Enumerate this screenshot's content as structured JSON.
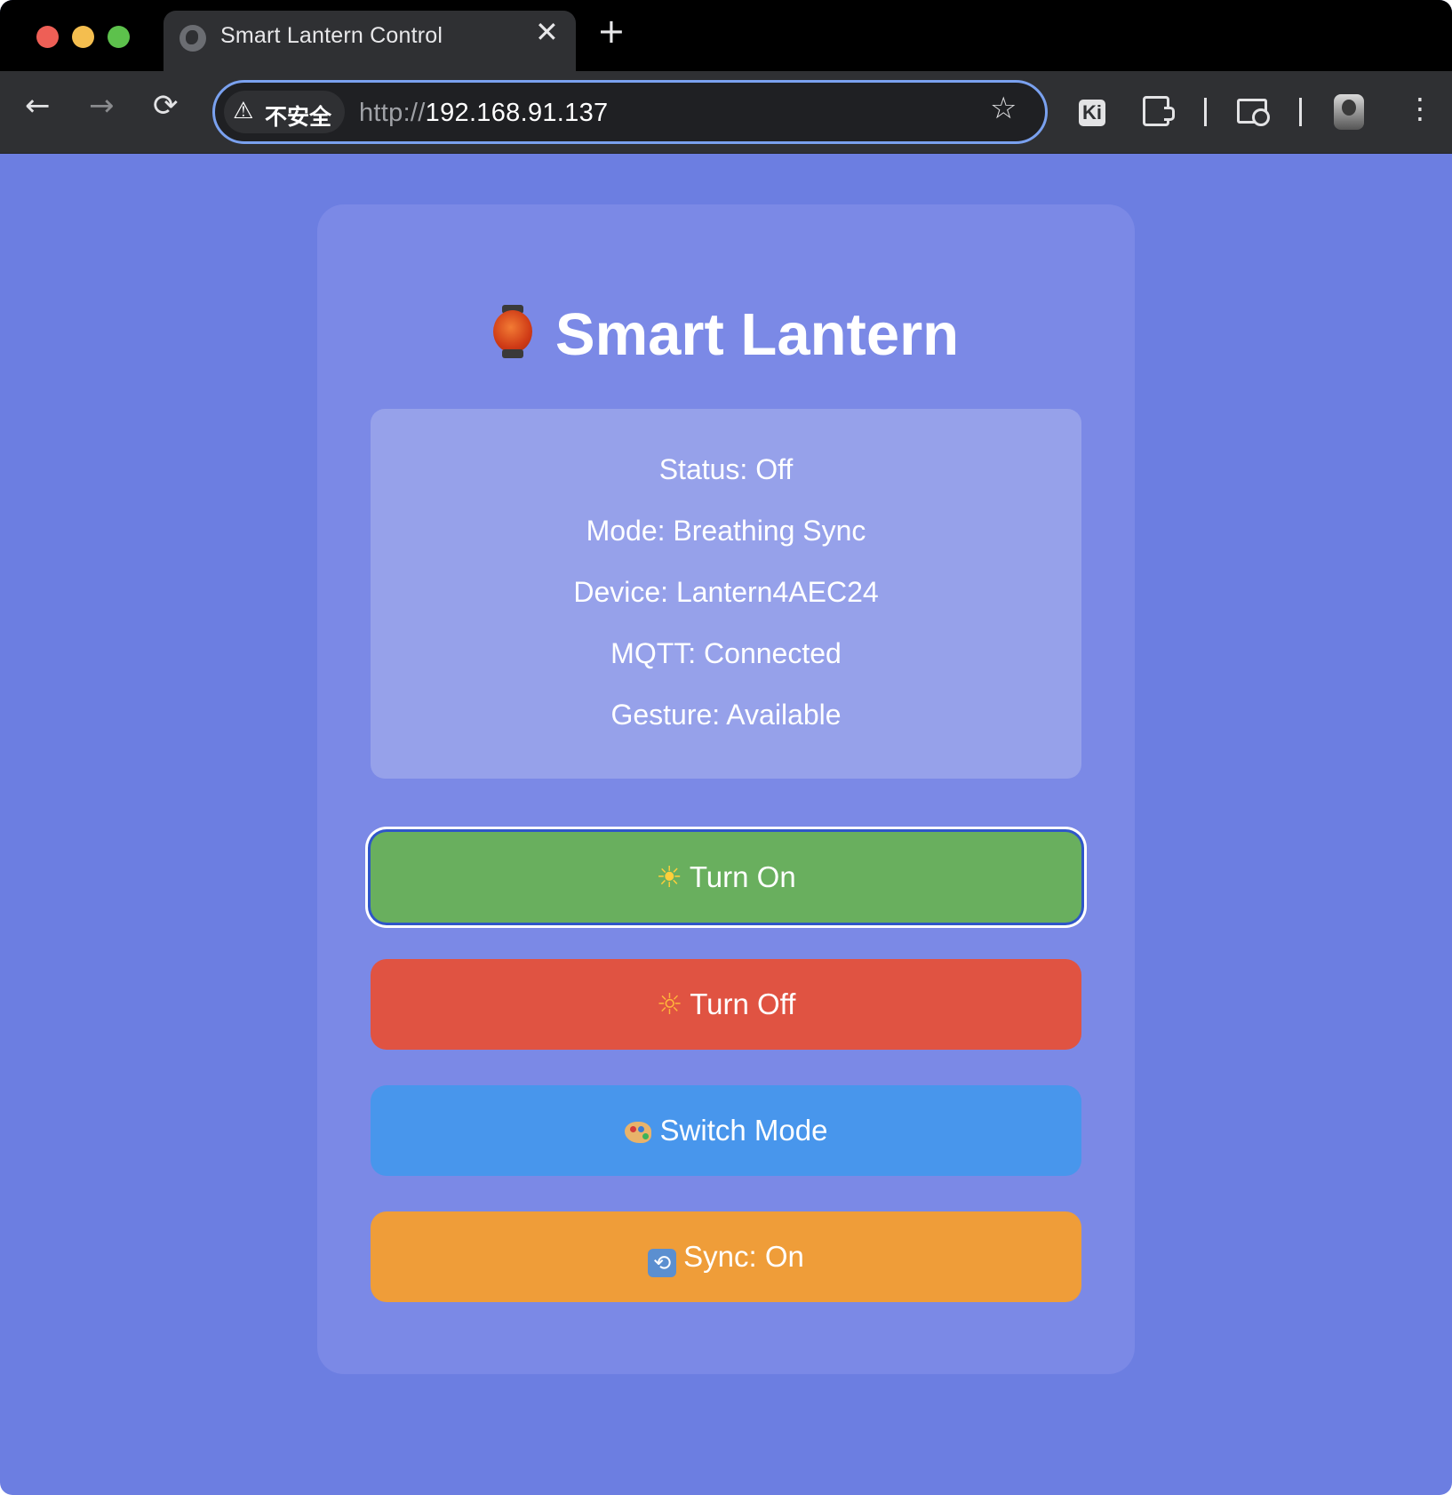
{
  "browser": {
    "tab_title": "Smart Lantern Control",
    "tab_close": "✕",
    "new_tab": "+",
    "back": "←",
    "forward": "→",
    "reload": "⟳",
    "security_label": "不安全",
    "warning": "⚠",
    "url_scheme": "http://",
    "url_host": "192.168.91.137",
    "star": "☆",
    "ext_ki": "Ki",
    "menu": "⋮"
  },
  "page": {
    "title": "Smart Lantern",
    "status": [
      "Status: Off",
      "Mode: Breathing Sync",
      "Device: Lantern4AEC24",
      "MQTT: Connected",
      "Gesture: Available"
    ],
    "buttons": {
      "turn_on_icon": "☀",
      "turn_on": "Turn On",
      "turn_off_icon": "☼",
      "turn_off": "Turn Off",
      "switch_mode": "Switch Mode",
      "sync_icon": "⟲",
      "sync": "Sync: On"
    }
  },
  "colors": {
    "page_background": "#6c7ee1",
    "card": "#7b89e6",
    "status_box": "#96a1ea",
    "turn_on": "#69af5e",
    "turn_off": "#e05342",
    "switch_mode": "#4896ec",
    "sync": "#ef9d39",
    "focus_ring": "#2f56c8"
  }
}
